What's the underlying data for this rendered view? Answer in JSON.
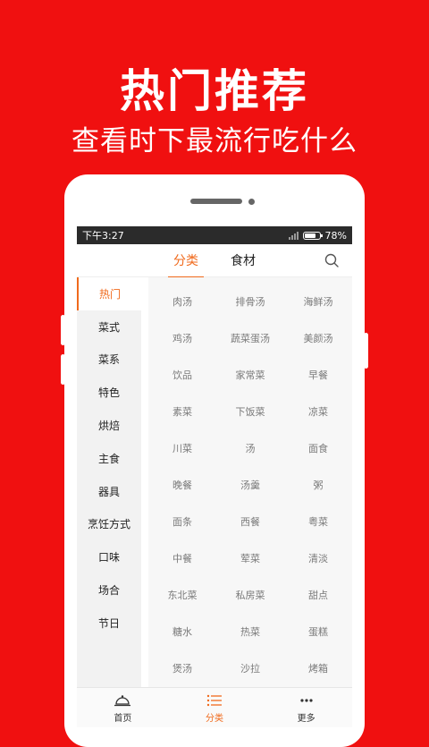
{
  "promo": {
    "title": "热门推荐",
    "subtitle": "查看时下最流行吃什么"
  },
  "status_bar": {
    "time": "下午3:27",
    "battery": "78%",
    "battery_level": 0.78
  },
  "top_tabs": [
    {
      "label": "分类",
      "active": true
    },
    {
      "label": "食材",
      "active": false
    }
  ],
  "sidebar": [
    {
      "label": "热门",
      "active": true
    },
    {
      "label": "菜式"
    },
    {
      "label": "菜系"
    },
    {
      "label": "特色"
    },
    {
      "label": "烘焙"
    },
    {
      "label": "主食"
    },
    {
      "label": "器具"
    },
    {
      "label": "烹饪方式"
    },
    {
      "label": "口味"
    },
    {
      "label": "场合"
    },
    {
      "label": "节日"
    }
  ],
  "categories": [
    "肉汤",
    "排骨汤",
    "海鲜汤",
    "鸡汤",
    "蔬菜蛋汤",
    "美颜汤",
    "饮品",
    "家常菜",
    "早餐",
    "素菜",
    "下饭菜",
    "凉菜",
    "川菜",
    "汤",
    "面食",
    "晚餐",
    "汤羹",
    "粥",
    "面条",
    "西餐",
    "粤菜",
    "中餐",
    "荤菜",
    "清淡",
    "东北菜",
    "私房菜",
    "甜点",
    "糖水",
    "热菜",
    "蛋糕",
    "煲汤",
    "沙拉",
    "烤箱"
  ],
  "bottom_nav": [
    {
      "label": "首页",
      "icon": "cloche-icon"
    },
    {
      "label": "分类",
      "icon": "list-icon",
      "active": true
    },
    {
      "label": "更多",
      "icon": "more-dots-icon"
    }
  ],
  "colors": {
    "background": "#f01010",
    "accent": "#f06a1c"
  }
}
